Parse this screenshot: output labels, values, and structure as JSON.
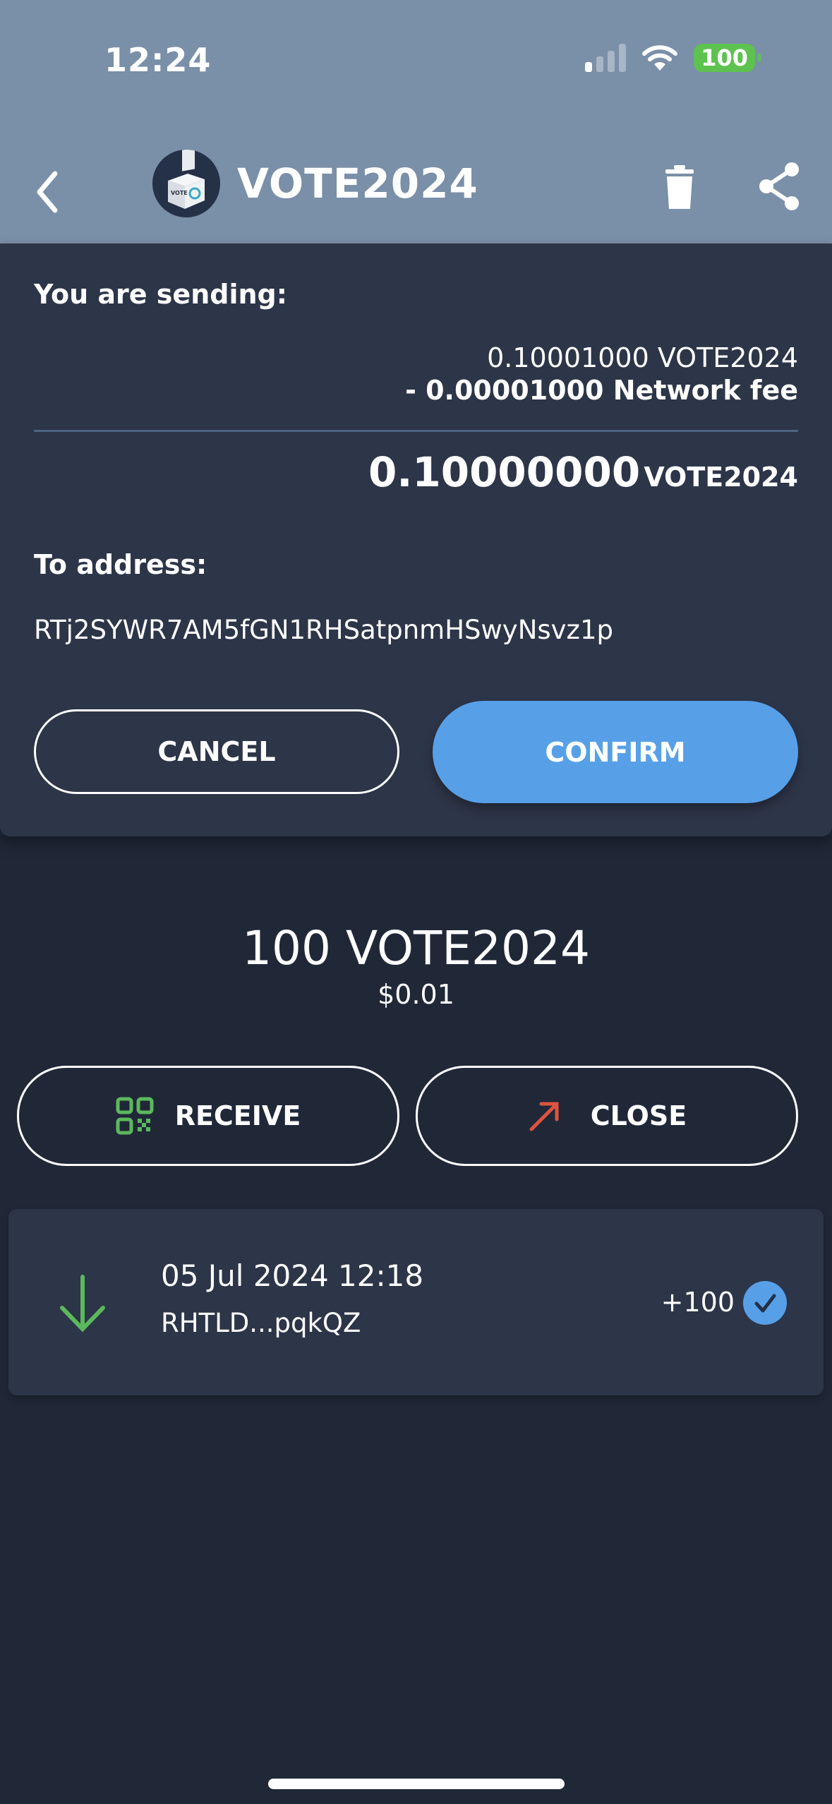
{
  "status_bar": {
    "time": "12:24",
    "battery": "100",
    "signal_bars_active": 1,
    "signal_bars_total": 4
  },
  "nav": {
    "title": "VOTE2024",
    "icons": [
      "back-chevron-icon",
      "ballot-box-icon",
      "trash-icon",
      "share-icon"
    ]
  },
  "confirm_dialog": {
    "sending_label": "You are sending:",
    "gross_amount": "0.10001000 VOTE2024",
    "fee_line": "- 0.00001000 Network fee",
    "net_amount": "0.10000000",
    "net_unit": "VOTE2024",
    "to_label": "To address:",
    "to_address": "RTj2SYWR7AM5fGN1RHSatpnmHSwyNsvz1p",
    "cancel_label": "CANCEL",
    "confirm_label": "CONFIRM"
  },
  "wallet": {
    "balance": "100 VOTE2024",
    "fiat_value": "$0.01",
    "receive_label": "RECEIVE",
    "close_label": "CLOSE"
  },
  "transactions": [
    {
      "direction": "incoming",
      "date": "05 Jul 2024 12:18",
      "address": "RHTLD...pqkQZ",
      "amount": "+100",
      "status": "confirmed"
    }
  ],
  "colors": {
    "header_bg": "#7a8fa8",
    "card_bg": "#2d3548",
    "page_bg": "#202838",
    "accent_blue": "#57a0e8",
    "receive_green": "#5cb85c",
    "send_red": "#e0533f",
    "battery_green": "#5ec24f"
  }
}
